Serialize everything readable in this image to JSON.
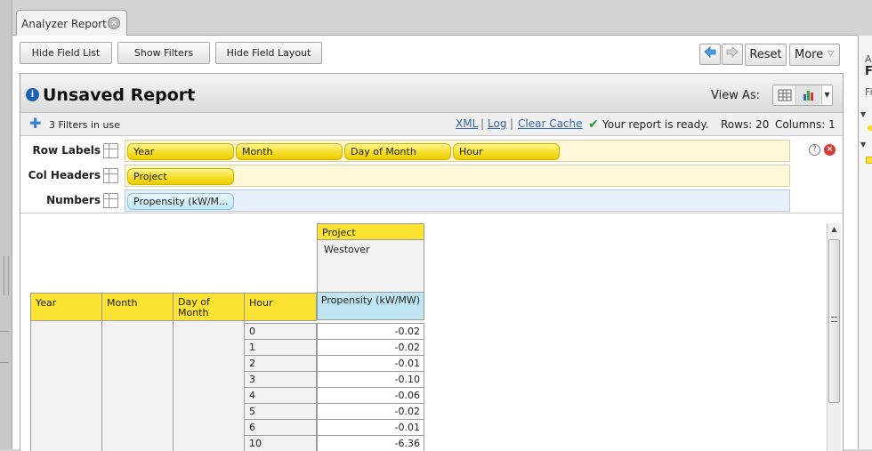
{
  "tab": {
    "title": "Analyzer Report"
  },
  "toolbar": {
    "hide_field_list": "Hide Field List",
    "show_filters": "Show Filters",
    "hide_field_layout": "Hide Field Layout",
    "reset": "Reset",
    "more": "More"
  },
  "report": {
    "title": "Unsaved Report",
    "view_as_label": "View As:",
    "filters_in_use": "3 Filters in use",
    "links": {
      "xml": "XML",
      "log": "Log",
      "clear_cache": "Clear Cache"
    },
    "status": "Your report is ready.",
    "rows": "Rows: 20",
    "columns": "Columns: 1"
  },
  "layout": {
    "row_labels_label": "Row Labels",
    "col_headers_label": "Col Headers",
    "numbers_label": "Numbers",
    "row_fields": [
      "Year",
      "Month",
      "Day of Month",
      "Hour"
    ],
    "col_fields": [
      "Project"
    ],
    "number_fields": [
      "Propensity (kW/M..."
    ]
  },
  "grid": {
    "col_header_title": "Project",
    "col_value": "Westover",
    "measure": "Propensity (kW/MW)",
    "row_headers": [
      "Year",
      "Month",
      "Day of Month",
      "Hour"
    ],
    "rows": [
      {
        "hour": "0",
        "value": "-0.02"
      },
      {
        "hour": "1",
        "value": "-0.02"
      },
      {
        "hour": "2",
        "value": "-0.01"
      },
      {
        "hour": "3",
        "value": "-0.10"
      },
      {
        "hour": "4",
        "value": "-0.06"
      },
      {
        "hour": "5",
        "value": "-0.02"
      },
      {
        "hour": "6",
        "value": "-0.01"
      },
      {
        "hour": "10",
        "value": "-6.36"
      }
    ]
  },
  "right_panel": {
    "line1": "A",
    "line2": "F",
    "line3": "Fi"
  },
  "colors": {
    "chip_yellow": "#f5dd24",
    "header_yellow": "#fce331",
    "measure_blue": "#bfe5f3",
    "link_blue": "#3366aa"
  }
}
